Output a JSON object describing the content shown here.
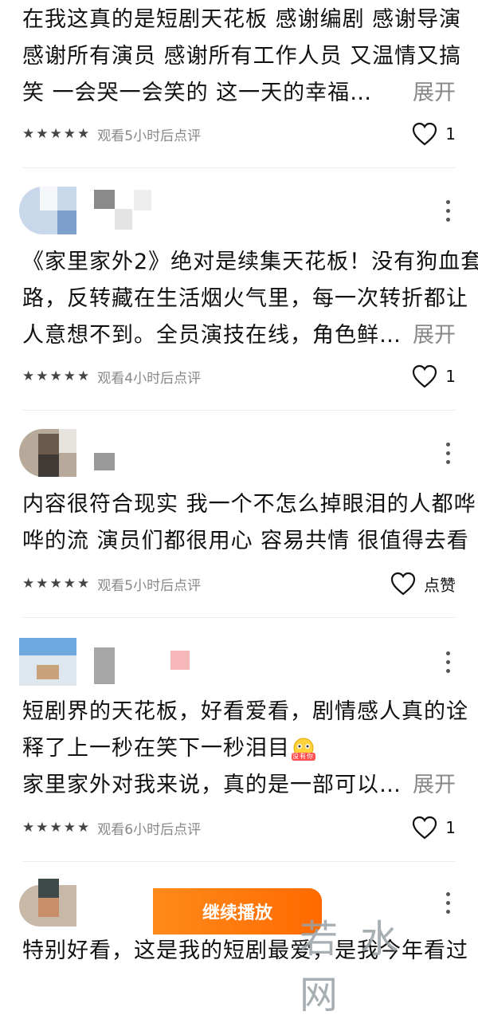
{
  "reviews": [
    {
      "text_lines": [
        "在我这真的是短剧天花板 感谢编剧 感谢导演",
        "感谢所有演员 感谢所有工作人员 又温情又搞",
        "笑 一会哭一会笑的 这一天的幸福…"
      ],
      "expand": "展开",
      "rating_stars": 5,
      "watch_note": "观看5小时后点评",
      "likes": "1"
    },
    {
      "text_lines": [
        "《家里家外2》绝对是续集天花板！没有狗血套",
        "路，反转藏在生活烟火气里，每一次转折都让",
        "人意想不到。全员演技在线，角色鲜…"
      ],
      "expand": "展开",
      "rating_stars": 5,
      "watch_note": "观看4小时后点评",
      "likes": "1"
    },
    {
      "text_lines": [
        "内容很符合现实 我一个不怎么掉眼泪的人都哗",
        "哗的流 演员们都很用心 容易共情 很值得去看"
      ],
      "rating_stars": 5,
      "watch_note": "观看5小时后点评",
      "likes": "点赞"
    },
    {
      "text_lines": [
        "短剧界的天花板，好看爱看，剧情感人真的诠",
        "释了上一秒在笑下一秒泪目",
        "家里家外对我来说，真的是一部可以…"
      ],
      "emoji_label": "没有你",
      "expand": "展开",
      "rating_stars": 5,
      "watch_note": "观看6小时后点评",
      "likes": "1"
    },
    {
      "text_lines": [
        "特别好看，这是我的短剧最爱，是我今年看过"
      ]
    }
  ],
  "continue_button": "继续播放",
  "watermark": "若水网",
  "icons": {
    "star": "star-icon",
    "heart": "heart-icon",
    "more": "more-vertical-icon"
  },
  "colors": {
    "accent": "#ff7a10",
    "muted": "#888888"
  }
}
